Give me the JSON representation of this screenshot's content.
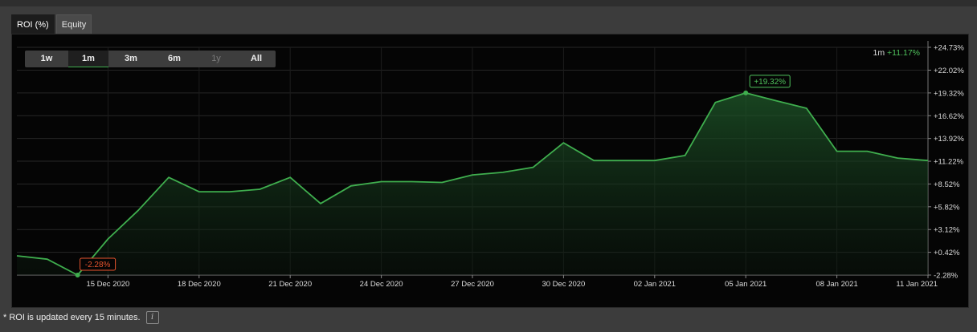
{
  "tabs": [
    {
      "label": "ROI (%)",
      "active": true
    },
    {
      "label": "Equity",
      "active": false
    }
  ],
  "range_buttons": [
    {
      "label": "1w",
      "active": false,
      "disabled": false
    },
    {
      "label": "1m",
      "active": true,
      "disabled": false
    },
    {
      "label": "3m",
      "active": false,
      "disabled": false
    },
    {
      "label": "6m",
      "active": false,
      "disabled": false
    },
    {
      "label": "1y",
      "active": false,
      "disabled": true
    },
    {
      "label": "All",
      "active": false,
      "disabled": false
    }
  ],
  "summary": {
    "period": "1m",
    "value": "+11.17%"
  },
  "footer": {
    "note": "* ROI is updated every 15 minutes.",
    "info_icon": "i"
  },
  "colors": {
    "line": "#3fae4e",
    "positive": "#4fc25c",
    "negative": "#e8542e"
  },
  "chart_data": {
    "type": "area",
    "y_ticks": [
      "+24.73%",
      "+22.02%",
      "+19.32%",
      "+16.62%",
      "+13.92%",
      "+11.22%",
      "+8.52%",
      "+5.82%",
      "+3.12%",
      "+0.42%",
      "-2.28%"
    ],
    "y_tick_values": [
      24.73,
      22.02,
      19.32,
      16.62,
      13.92,
      11.22,
      8.52,
      5.82,
      3.12,
      0.42,
      -2.28
    ],
    "ylim": [
      -2.28,
      24.73
    ],
    "x_ticks": [
      "15 Dec 2020",
      "18 Dec 2020",
      "21 Dec 2020",
      "24 Dec 2020",
      "27 Dec 2020",
      "30 Dec 2020",
      "02 Jan 2021",
      "05 Jan 2021",
      "08 Jan 2021",
      "11 Jan 2021"
    ],
    "x_tick_days": [
      3,
      6,
      9,
      12,
      15,
      18,
      21,
      24,
      27,
      30
    ],
    "xlim": [
      0,
      30
    ],
    "points": [
      {
        "x": 0,
        "y": 0.0
      },
      {
        "x": 1,
        "y": -0.4
      },
      {
        "x": 2,
        "y": -2.28
      },
      {
        "x": 3,
        "y": 2.0
      },
      {
        "x": 4,
        "y": 5.4
      },
      {
        "x": 5,
        "y": 9.3
      },
      {
        "x": 6,
        "y": 7.6
      },
      {
        "x": 7,
        "y": 7.6
      },
      {
        "x": 8,
        "y": 7.9
      },
      {
        "x": 9,
        "y": 9.3
      },
      {
        "x": 10,
        "y": 6.2
      },
      {
        "x": 11,
        "y": 8.3
      },
      {
        "x": 12,
        "y": 8.8
      },
      {
        "x": 13,
        "y": 8.8
      },
      {
        "x": 14,
        "y": 8.7
      },
      {
        "x": 15,
        "y": 9.6
      },
      {
        "x": 16,
        "y": 9.9
      },
      {
        "x": 17,
        "y": 10.5
      },
      {
        "x": 18,
        "y": 13.4
      },
      {
        "x": 19,
        "y": 11.3
      },
      {
        "x": 20,
        "y": 11.3
      },
      {
        "x": 21,
        "y": 11.3
      },
      {
        "x": 22,
        "y": 11.9
      },
      {
        "x": 23,
        "y": 18.2
      },
      {
        "x": 24,
        "y": 19.32
      },
      {
        "x": 25,
        "y": 18.4
      },
      {
        "x": 26,
        "y": 17.5
      },
      {
        "x": 27,
        "y": 12.4
      },
      {
        "x": 28,
        "y": 12.4
      },
      {
        "x": 29,
        "y": 11.6
      },
      {
        "x": 30,
        "y": 11.3
      }
    ],
    "annotations": [
      {
        "label": "+19.32%",
        "x": 24,
        "y": 19.32,
        "kind": "max"
      },
      {
        "label": "-2.28%",
        "x": 2,
        "y": -2.28,
        "kind": "min"
      }
    ],
    "grid": true
  }
}
